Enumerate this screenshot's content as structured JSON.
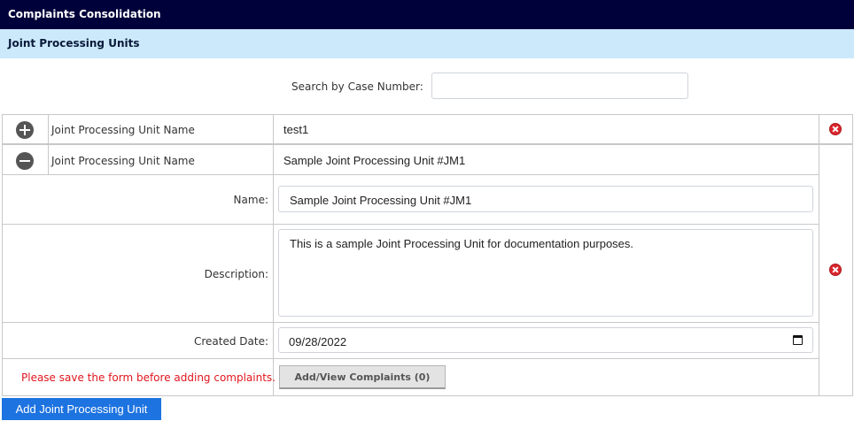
{
  "header": {
    "title": "Complaints Consolidation"
  },
  "section": {
    "title": "Joint Processing Units"
  },
  "search": {
    "label": "Search by Case Number:",
    "value": ""
  },
  "rows": [
    {
      "label": "Joint Processing Unit Name",
      "value": "test1",
      "expanded": false
    },
    {
      "label": "Joint Processing Unit Name",
      "value": "Sample Joint Processing Unit #JM1",
      "expanded": true
    }
  ],
  "form": {
    "name_label": "Name:",
    "name_value": "Sample Joint Processing Unit #JM1",
    "description_label": "Description:",
    "description_value": "This is a sample Joint Processing Unit for documentation purposes.",
    "created_date_label": "Created Date:",
    "created_date_value": "09/28/2022",
    "warning": "Please save the form before adding complaints.",
    "complaints_button": "Add/View Complaints (0)"
  },
  "add_button": "Add Joint Processing Unit",
  "icons": {
    "expand": "plus-circle-icon",
    "collapse": "minus-circle-icon",
    "delete": "close-circle-icon",
    "calendar": "calendar-icon"
  },
  "colors": {
    "header_bg": "#00003a",
    "subheader_bg": "#cce9fb",
    "primary_button": "#1d73e0",
    "warning_text": "#e0161e",
    "delete_icon": "#d9262c"
  }
}
